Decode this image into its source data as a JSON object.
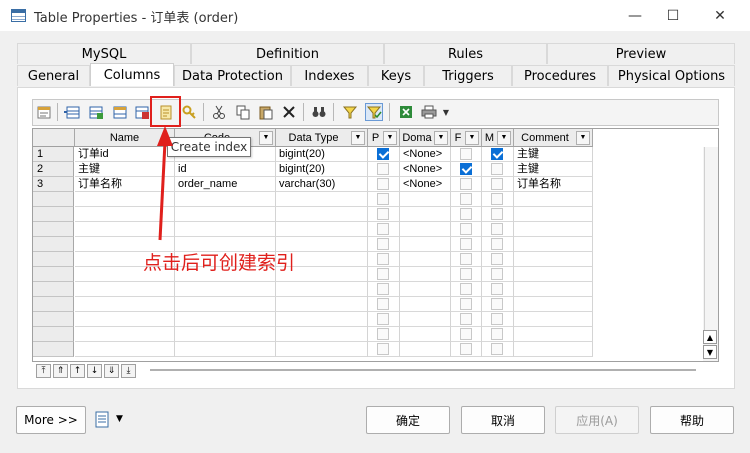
{
  "window": {
    "title": "Table Properties - 订单表 (order)",
    "minimize": "—",
    "maximize": "☐",
    "close": "✕"
  },
  "tabs_row1": [
    {
      "label": "MySQL"
    },
    {
      "label": "Definition"
    },
    {
      "label": "Rules"
    },
    {
      "label": "Preview"
    }
  ],
  "tabs_row2": [
    {
      "label": "General"
    },
    {
      "label": "Columns",
      "active": true
    },
    {
      "label": "Data Protection"
    },
    {
      "label": "Indexes"
    },
    {
      "label": "Keys"
    },
    {
      "label": "Triggers"
    },
    {
      "label": "Procedures"
    },
    {
      "label": "Physical Options"
    }
  ],
  "toolbar": {
    "tooltip": "Create index"
  },
  "grid": {
    "columns": [
      {
        "label": "Name"
      },
      {
        "label": "Code"
      },
      {
        "label": "Data Type"
      },
      {
        "label": "P"
      },
      {
        "label": "Doma"
      },
      {
        "label": "F"
      },
      {
        "label": "M"
      },
      {
        "label": "Comment"
      }
    ],
    "rows": [
      {
        "num": "1",
        "name": "订单id",
        "code": "",
        "type": "bigint(20)",
        "p": true,
        "domain": "<None>",
        "f": false,
        "m": true,
        "comment": "主键"
      },
      {
        "num": "2",
        "name": "主键",
        "code": "id",
        "type": "bigint(20)",
        "p": false,
        "domain": "<None>",
        "f": true,
        "m": false,
        "comment": "主键"
      },
      {
        "num": "3",
        "name": "订单名称",
        "code": "order_name",
        "type": "varchar(30)",
        "p": false,
        "domain": "<None>",
        "f": false,
        "m": false,
        "comment": "订单名称"
      }
    ]
  },
  "annotation": {
    "text": "点击后可创建索引"
  },
  "buttons": {
    "more": "More >>",
    "ok": "确定",
    "cancel": "取消",
    "apply": "应用(A)",
    "help": "帮助"
  },
  "colors": {
    "annotation": "#e0201c",
    "checkbox": "#0a6fd6"
  }
}
